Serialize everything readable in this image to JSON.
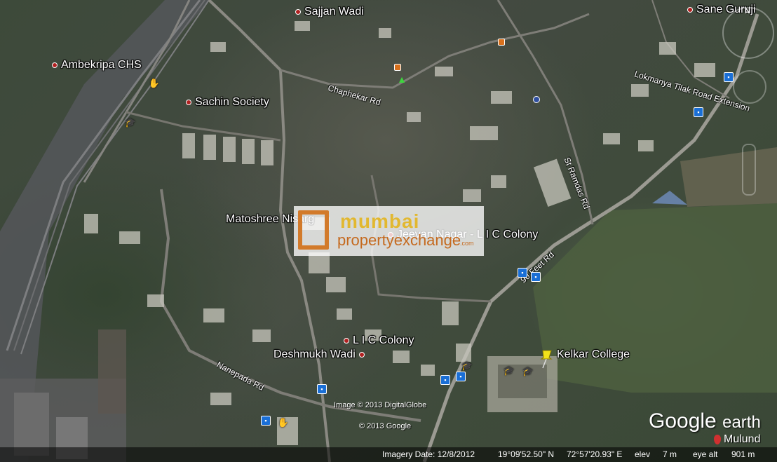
{
  "places": [
    {
      "id": "sajjan-wadi",
      "label": "Sajjan Wadi"
    },
    {
      "id": "sane-guruji",
      "label": "Sane Guruji"
    },
    {
      "id": "ambekripa-chs",
      "label": "Ambekripa CHS"
    },
    {
      "id": "sachin-society",
      "label": "Sachin Society"
    },
    {
      "id": "matoshree-nisarg",
      "label": "Matoshree Nisarg"
    },
    {
      "id": "jeevan-nagar",
      "label": "Jeevan Nagar - L I C Colony"
    },
    {
      "id": "lic-colony",
      "label": "L I C Colony"
    },
    {
      "id": "deshmukh-wadi",
      "label": "Deshmukh Wadi"
    },
    {
      "id": "kelkar-college",
      "label": "Kelkar College"
    }
  ],
  "roads": {
    "chaphekar": "Chaphekar Rd",
    "lokmanya": "Lokmanya Tilak Road Extension",
    "ramdas": "St Ramdas Rd",
    "ninety_feet": "90 Feet Rd",
    "nanepada": "Nanepada Rd"
  },
  "logo": {
    "line1": "mumbai",
    "line2": "propertyexchange",
    "line3": ".com"
  },
  "credits": {
    "imagery_copyright": "Image © 2013 DigitalGlobe",
    "google_copyright": "© 2013 Google"
  },
  "brand": {
    "name": "Google",
    "suffix": "earth"
  },
  "location_label": "Mulund",
  "compass_north": "N",
  "status": {
    "imagery_date": "Imagery Date: 12/8/2012",
    "lat": "19°09'52.50\" N",
    "lon": "72°57'20.93\" E",
    "elev_label": "elev",
    "elev_value": "7 m",
    "eye_alt_label": "eye alt",
    "eye_alt_value": "901 m"
  },
  "colors": {
    "place_dot": "#b02020",
    "bus_stop": "#1a6fd6",
    "logo_orange": "#d27a2a",
    "logo_yellow": "#e2b830",
    "pin": "#f2e21a"
  }
}
